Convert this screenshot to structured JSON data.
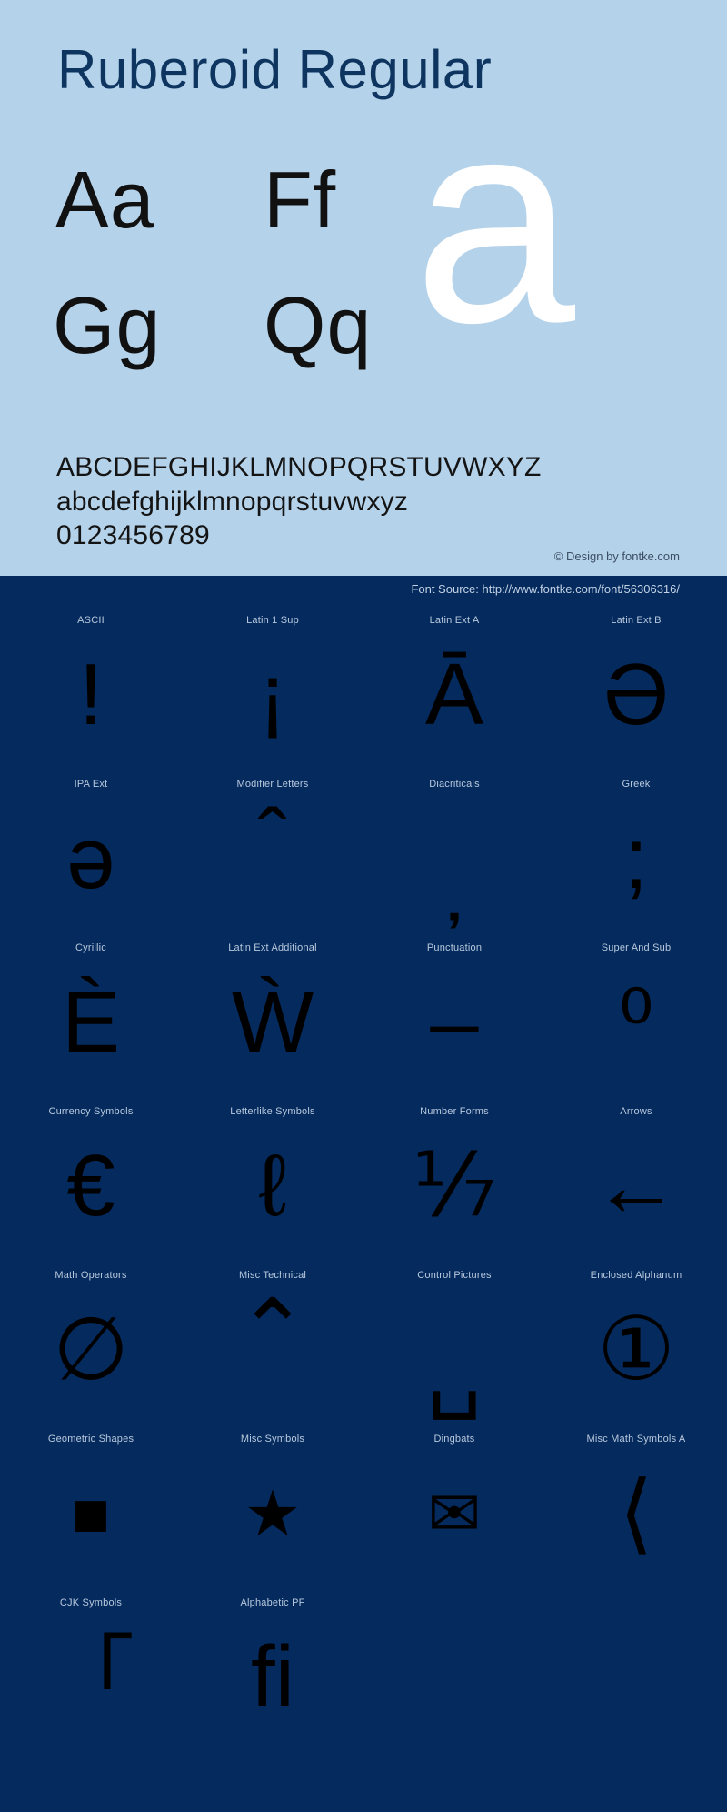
{
  "specimen": {
    "title": "Ruberoid Regular",
    "sample_pairs": [
      "Aa",
      "Ff",
      "Gg",
      "Qq"
    ],
    "watermark_glyph": "a",
    "alphabet_upper": "ABCDEFGHIJKLMNOPQRSTUVWXYZ",
    "alphabet_lower": "abcdefghijklmnopqrstuvwxyz",
    "digits": "0123456789",
    "credit": "© Design by fontke.com",
    "source_line": "Font Source: http://www.fontke.com/font/56306316/",
    "colors": {
      "top_background": "#b4d2ea",
      "title_text": "#0d3560",
      "dark_background": "#042a5e",
      "watermark": "#ffffff",
      "block_label": "#b9c9dd",
      "glyph": "#000000"
    }
  },
  "unicode_blocks": {
    "rows": [
      [
        {
          "label": "ASCII",
          "glyph": "!",
          "size": "normal",
          "shift": "none"
        },
        {
          "label": "Latin 1 Sup",
          "glyph": "¡",
          "size": "normal",
          "shift": "none"
        },
        {
          "label": "Latin Ext A",
          "glyph": "Ā",
          "size": "normal",
          "shift": "none"
        },
        {
          "label": "Latin Ext B",
          "glyph": "Ə",
          "size": "normal",
          "shift": "none"
        }
      ],
      [
        {
          "label": "IPA Ext",
          "glyph": "ə",
          "size": "normal",
          "shift": "none"
        },
        {
          "label": "Modifier Letters",
          "glyph": "ˆ",
          "size": "normal",
          "shift": "raise"
        },
        {
          "label": "Diacriticals",
          "glyph": "̦",
          "size": "normal",
          "shift": "drop"
        },
        {
          "label": "Greek",
          "glyph": ";",
          "size": "normal",
          "shift": "none"
        }
      ],
      [
        {
          "label": "Cyrillic",
          "glyph": "Ѐ",
          "size": "normal",
          "shift": "none"
        },
        {
          "label": "Latin Ext Additional",
          "glyph": "Ẁ",
          "size": "normal",
          "shift": "none"
        },
        {
          "label": "Punctuation",
          "glyph": "–",
          "size": "normal",
          "shift": "none"
        },
        {
          "label": "Super And Sub",
          "glyph": "⁰",
          "size": "normal",
          "shift": "none"
        }
      ],
      [
        {
          "label": "Currency Symbols",
          "glyph": "€",
          "size": "normal",
          "shift": "none"
        },
        {
          "label": "Letterlike Symbols",
          "glyph": "ℓ",
          "size": "normal",
          "shift": "none"
        },
        {
          "label": "Number Forms",
          "glyph": "⅐",
          "size": "normal",
          "shift": "none"
        },
        {
          "label": "Arrows",
          "glyph": "←",
          "size": "normal",
          "shift": "none"
        }
      ],
      [
        {
          "label": "Math Operators",
          "glyph": "∅",
          "size": "normal",
          "shift": "none"
        },
        {
          "label": "Misc Technical",
          "glyph": "⌃",
          "size": "normal",
          "shift": "raise"
        },
        {
          "label": "Control Pictures",
          "glyph": "␣",
          "size": "normal",
          "shift": "drop"
        },
        {
          "label": "Enclosed Alphanum",
          "glyph": "①",
          "size": "normal",
          "shift": "none"
        }
      ],
      [
        {
          "label": "Geometric Shapes",
          "glyph": "■",
          "size": "small",
          "shift": "none"
        },
        {
          "label": "Misc Symbols",
          "glyph": "★",
          "size": "small",
          "shift": "none"
        },
        {
          "label": "Dingbats",
          "glyph": "✉",
          "size": "small",
          "shift": "none"
        },
        {
          "label": "Misc Math Symbols A",
          "glyph": "⟨",
          "size": "normal",
          "shift": "none"
        }
      ],
      [
        {
          "label": "CJK Symbols",
          "glyph": "「",
          "size": "normal",
          "shift": "none"
        },
        {
          "label": "Alphabetic PF",
          "glyph": "ﬁ",
          "size": "normal",
          "shift": "none"
        },
        {
          "label": "",
          "glyph": "",
          "size": "normal",
          "shift": "none"
        },
        {
          "label": "",
          "glyph": "",
          "size": "normal",
          "shift": "none"
        }
      ]
    ]
  }
}
